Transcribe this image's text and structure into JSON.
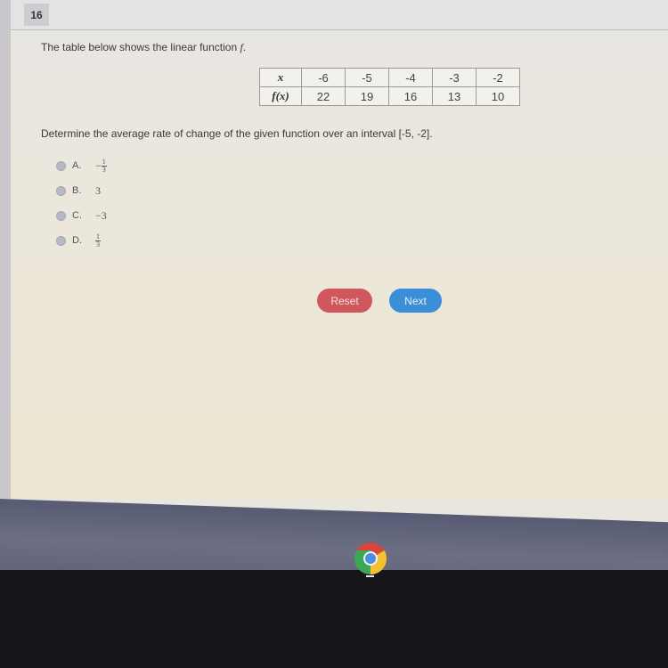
{
  "question": {
    "number": "16",
    "intro_text": "The table below shows the linear function ",
    "function_name": "f",
    "intro_end": ".",
    "table": {
      "row_labels": [
        "x",
        "f(x)"
      ],
      "x": [
        "-6",
        "-5",
        "-4",
        "-3",
        "-2"
      ],
      "fx": [
        "22",
        "19",
        "16",
        "13",
        "10"
      ]
    },
    "prompt": "Determine the average rate of change of the given function over an interval [-5, -2].",
    "options": [
      {
        "letter": "A.",
        "sign": "−",
        "numerator": "1",
        "denominator": "3",
        "selected": false
      },
      {
        "letter": "B.",
        "value": "3",
        "selected": false
      },
      {
        "letter": "C.",
        "value": "−3",
        "selected": false
      },
      {
        "letter": "D.",
        "sign": "",
        "numerator": "1",
        "denominator": "3",
        "selected": false
      }
    ]
  },
  "buttons": {
    "reset": "Reset",
    "next": "Next"
  },
  "colors": {
    "reset": "#d0585c",
    "next": "#3a8fd8"
  },
  "taskbar": {
    "apps": [
      {
        "icon": "chrome-icon",
        "active": true
      }
    ]
  }
}
